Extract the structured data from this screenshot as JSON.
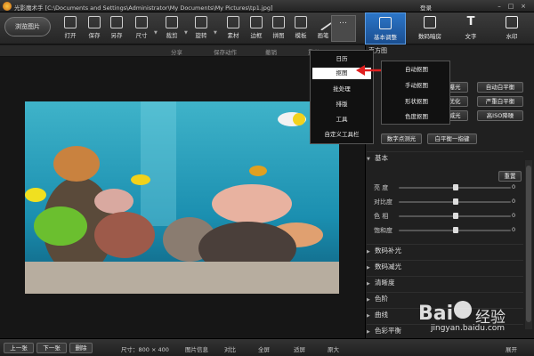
{
  "titlebar": {
    "title": "光影魔术手 [C:\\Documents and Settings\\Administrator\\My Documents\\My Pictures\\tp1.jpg]",
    "login": "登录",
    "min": "–",
    "max": "□",
    "close": "×"
  },
  "toolbar": {
    "browse": "浏览图片",
    "tools": [
      "打开",
      "保存",
      "另存",
      "尺寸",
      "裁剪",
      "旋转",
      "素材",
      "边框",
      "拼图",
      "模板",
      "画笔",
      "…"
    ],
    "tabs": [
      {
        "label": "基本调整",
        "active": true
      },
      {
        "label": "数码暗房",
        "active": false
      },
      {
        "label": "文字",
        "active": false
      },
      {
        "label": "水印",
        "active": false
      }
    ]
  },
  "subbar": {
    "share": "分享",
    "save_action": "保存动作",
    "undo": "撤销",
    "redo": "重做"
  },
  "right_panel": {
    "title": "直方图",
    "auto_buttons": [
      "自动白平衡",
      "严重白平衡",
      "高ISO降噪"
    ],
    "partial_buttons": [
      "曝光",
      "优化",
      "减光"
    ],
    "action_buttons": [
      "数字点测光",
      "白平衡一指键"
    ],
    "basic_section": "基本",
    "reset": "重置",
    "sliders": [
      {
        "label": "亮 度",
        "value": "0"
      },
      {
        "label": "对比度",
        "value": "0"
      },
      {
        "label": "色 相",
        "value": "0"
      },
      {
        "label": "饱和度",
        "value": "0"
      }
    ],
    "sections": [
      "数码补光",
      "数码减光",
      "清晰度",
      "色阶",
      "曲线",
      "色彩平衡"
    ]
  },
  "menu": {
    "items": [
      "日历",
      "抠图",
      "批处理",
      "排版",
      "工具",
      "自定义工具栏"
    ],
    "highlighted": 1
  },
  "submenu": {
    "items": [
      "自动抠图",
      "手动抠图",
      "形状抠图",
      "色度抠图"
    ]
  },
  "bottombar": {
    "prev": "上一张",
    "next": "下一张",
    "delete": "删除",
    "size": "尺寸：800 × 400",
    "info": "图片信息",
    "compare": "对比",
    "fullscreen": "全屏",
    "fit": "适屏",
    "original": "原大",
    "expand": "展开"
  },
  "watermark": {
    "brand": "Bai",
    "brand2": "经验",
    "url": "jingyan.baidu.com"
  },
  "colors": {
    "accent": "#2c76c9",
    "arrow": "#e02020"
  }
}
